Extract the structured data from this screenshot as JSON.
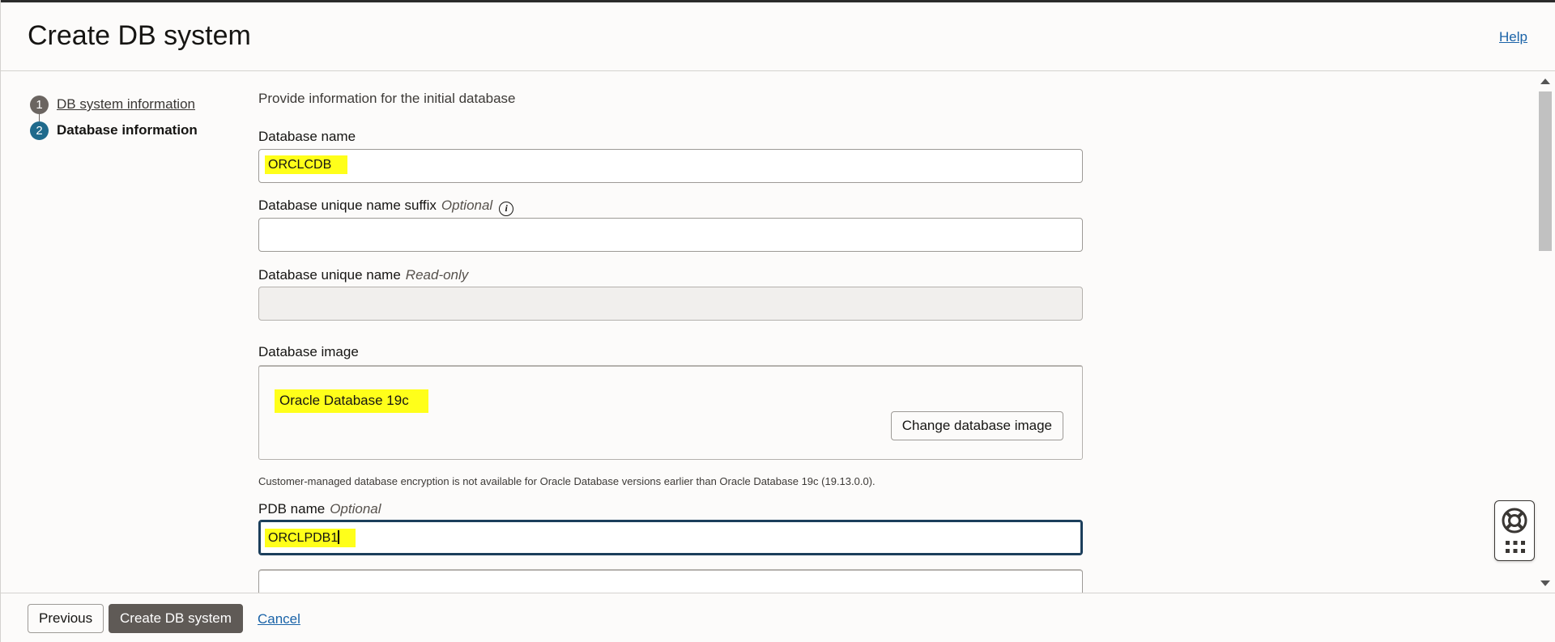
{
  "header": {
    "title": "Create DB system",
    "help": "Help"
  },
  "steps": [
    {
      "number": "1",
      "label": "DB system information",
      "state": "completed"
    },
    {
      "number": "2",
      "label": "Database information",
      "state": "active"
    }
  ],
  "form": {
    "intro": "Provide information for the initial database",
    "db_name": {
      "label": "Database name",
      "value": "ORCLCDB"
    },
    "unique_suffix": {
      "label": "Database unique name suffix",
      "qualifier": "Optional",
      "value": "",
      "info_icon": "info-icon"
    },
    "unique_name": {
      "label": "Database unique name",
      "qualifier": "Read-only",
      "value": ""
    },
    "db_image": {
      "label": "Database image",
      "value": "Oracle Database 19c",
      "change_button": "Change database image"
    },
    "note": "Customer-managed database encryption is not available for Oracle Database versions earlier than Oracle Database 19c (19.13.0.0).",
    "pdb_name": {
      "label": "PDB name",
      "qualifier": "Optional",
      "value": "ORCLPDB1"
    }
  },
  "footer": {
    "previous": "Previous",
    "create": "Create DB system",
    "cancel": "Cancel"
  },
  "colors": {
    "highlight": "#ffff1a",
    "link": "#1a63a8",
    "active_step": "#1f6a8c",
    "primary_button": "#5f5a56"
  }
}
